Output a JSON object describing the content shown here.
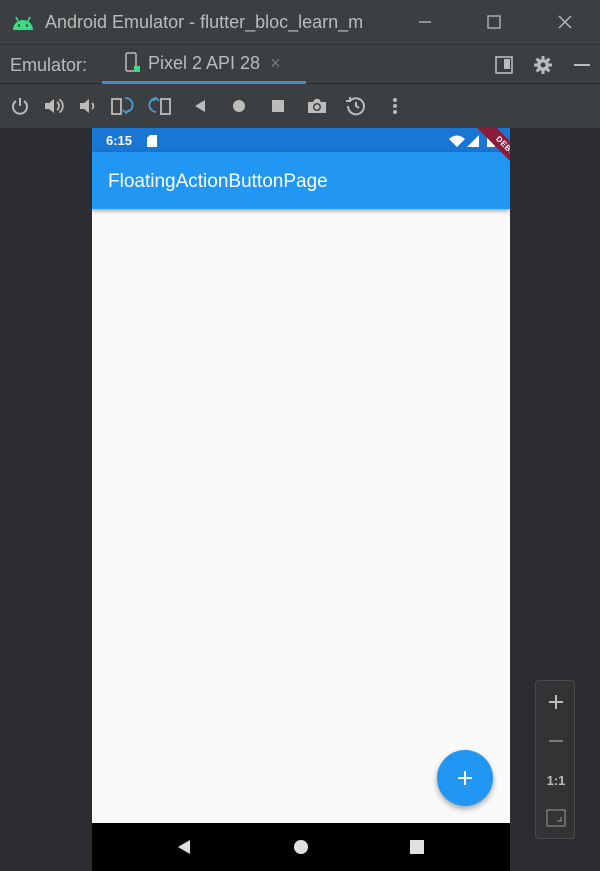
{
  "window": {
    "title": "Android Emulator - flutter_bloc_learn_m",
    "android_icon": "android-logo-icon",
    "minimize_icon": "minimize-icon",
    "maximize_icon": "maximize-icon",
    "close_icon": "close-icon"
  },
  "emulator_tabs": {
    "label": "Emulator:",
    "active_tab": {
      "label": "Pixel 2 API 28",
      "icon": "device-icon",
      "close_glyph": "×"
    },
    "right_icons": [
      "layout-icon",
      "gear-icon",
      "minimize-panel-icon"
    ]
  },
  "toolbar": {
    "icons": [
      "power-icon",
      "volume-up-icon",
      "volume-down-icon",
      "rotate-left-icon",
      "rotate-right-icon",
      "back-icon",
      "home-icon",
      "overview-icon",
      "camera-icon",
      "snapshot-restore-icon",
      "more-icon"
    ]
  },
  "device": {
    "status_bar": {
      "time": "6:15"
    },
    "app_bar": {
      "title": "FloatingActionButtonPage"
    },
    "debug_banner": "DEBUG",
    "fab": {
      "glyph": "+"
    },
    "colors": {
      "status_bar": "#1976d2",
      "app_bar": "#2196f3",
      "fab": "#2196f3",
      "background": "#fafafa",
      "debug_banner": "#8b1d3a"
    }
  },
  "zoom_panel": {
    "zoom_in": "+",
    "zoom_out": "−",
    "actual_size": "1:1",
    "fit_icon": "fit-screen-icon"
  }
}
